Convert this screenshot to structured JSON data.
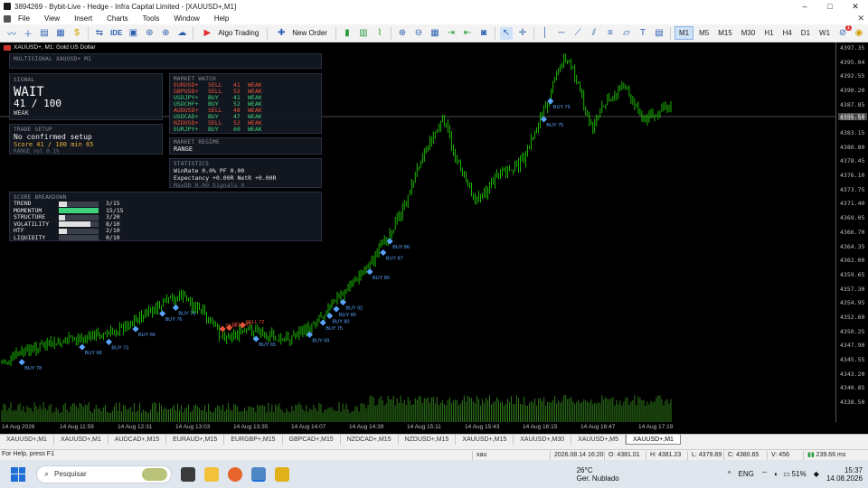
{
  "window": {
    "title": "3894269 - Bybit-Live - Hedge - Infra Capital Limited - [XAUUSD+,M1]",
    "controls": [
      "–",
      "□",
      "✕"
    ]
  },
  "menu": [
    "File",
    "View",
    "Insert",
    "Charts",
    "Tools",
    "Window",
    "Help"
  ],
  "toolbar": {
    "ide_label": "IDE",
    "algo_label": "Algo Trading",
    "neworder_label": "New Order",
    "timeframes": [
      "M1",
      "M5",
      "M15",
      "M30",
      "H1",
      "H4",
      "D1",
      "W1"
    ],
    "active_tf": "M1",
    "notif_count": "1"
  },
  "chart": {
    "symbol_title": "XAUUSD+, M1:  Gold US Dollar",
    "current_price": "4385.50",
    "price_labels": [
      "4397.35",
      "4395.04",
      "4392.55",
      "4390.20",
      "4387.85",
      "4385.50",
      "4383.15",
      "4380.80",
      "4378.45",
      "4376.10",
      "4373.75",
      "4371.40",
      "4369.05",
      "4366.70",
      "4364.35",
      "4362.00",
      "4359.65",
      "4357.30",
      "4354.95",
      "4352.60",
      "4350.25",
      "4347.90",
      "4345.55",
      "4343.20",
      "4340.85",
      "4338.50"
    ],
    "time_labels": [
      "14 Aug 2026",
      "14 Aug 11:59",
      "14 Aug 12:31",
      "14 Aug 13:03",
      "14 Aug 13:35",
      "14 Aug 14:07",
      "14 Aug 14:39",
      "14 Aug 15:11",
      "14 Aug 15:43",
      "14 Aug 16:15",
      "14 Aug 16:47",
      "14 Aug 17:19"
    ]
  },
  "panels": {
    "header": "MULTISIGNAL   XAUUSD+ M1",
    "signal": {
      "title": "SIGNAL",
      "state": "WAIT",
      "score": "41 / 100",
      "strength": "WEAK"
    },
    "trade_setup": {
      "title": "TRADE SETUP",
      "line1": "No confirmed setup",
      "line2": "Score 41 / 100   min 65",
      "line3": "RANGE   vol 0.1%"
    },
    "market_watch": {
      "title": "MARKET WATCH",
      "rows": [
        {
          "sym": "EURUSD+",
          "dir": "SELL",
          "score": "41",
          "str": "WEAK"
        },
        {
          "sym": "GBPUSD+",
          "dir": "SELL",
          "score": "52",
          "str": "WEAK"
        },
        {
          "sym": "USDJPY+",
          "dir": "BUY",
          "score": "41",
          "str": "WEAK"
        },
        {
          "sym": "USDCHF+",
          "dir": "BUY",
          "score": "52",
          "str": "WEAK"
        },
        {
          "sym": "AUDUSD+",
          "dir": "SELL",
          "score": "48",
          "str": "WEAK"
        },
        {
          "sym": "USDCAD+",
          "dir": "BUY",
          "score": "47",
          "str": "WEAK"
        },
        {
          "sym": "NZDUSD+",
          "dir": "SELL",
          "score": "52",
          "str": "WEAK"
        },
        {
          "sym": "EURJPY+",
          "dir": "BUY",
          "score": "60",
          "str": "WEAK"
        }
      ]
    },
    "regime": {
      "title": "MARKET REGIME",
      "value": "RANGE"
    },
    "statistics": {
      "title": "STATISTICS",
      "line1": "WinRate 0.0%    PF 0.00",
      "line2": "Expectancy +0.00R    NetR +0.00R",
      "line3": "MaxDD 0.00    Signals 0"
    },
    "breakdown": {
      "title": "SCORE BREAKDOWN",
      "rows": [
        {
          "name": "TREND",
          "val": "3/15",
          "frac": 0.2
        },
        {
          "name": "MOMENTUM",
          "val": "15/15",
          "frac": 1.0
        },
        {
          "name": "STRUCTURE",
          "val": "3/20",
          "frac": 0.15
        },
        {
          "name": "VOLATILITY",
          "val": "8/10",
          "frac": 0.8
        },
        {
          "name": "HTF",
          "val": "2/10",
          "frac": 0.2
        },
        {
          "name": "LIQUIDITY",
          "val": "0/10",
          "frac": 0.0
        }
      ]
    }
  },
  "signals_on_chart": [
    {
      "label": "BUY 78"
    },
    {
      "label": "BUY 68"
    },
    {
      "label": "BUY 73"
    },
    {
      "label": "BUY 66"
    },
    {
      "label": "BUY 78"
    },
    {
      "label": "BUY 76"
    },
    {
      "label": "SELL 69"
    },
    {
      "label": "SELL 63"
    },
    {
      "label": "SELL 72"
    },
    {
      "label": "BUY 65"
    },
    {
      "label": "BUY 69"
    },
    {
      "label": "BUY 80"
    },
    {
      "label": "BUY 75"
    },
    {
      "label": "BUY 92"
    },
    {
      "label": "BUY 80"
    },
    {
      "label": "BUY 80"
    },
    {
      "label": "BUY 87"
    },
    {
      "label": "BUY 86"
    },
    {
      "label": "BUY 75"
    },
    {
      "label": "BUY 76"
    }
  ],
  "tabs": [
    "XAUUSD+,M1",
    "XAUUSD+,M1",
    "AUDCAD+,M15",
    "EURAUD+,M15",
    "EURGBP+,M15",
    "GBPCAD+,M15",
    "NZDCAD+,M15",
    "NZDUSD+,M15",
    "XAUUSD+,M15",
    "XAUUSD+,M30",
    "XAUUSD+,M5",
    "XAUUSD+,M1"
  ],
  "active_tab_index": 11,
  "status": {
    "help": "For Help, press F1",
    "profile": "xau",
    "datetime": "2026.08.14 16:20",
    "open": "O: 4381.01",
    "high": "H: 4381.23",
    "low": "L: 4379.89",
    "close": "C: 4380.65",
    "volume": "V: 456",
    "ping": "239.66 ms"
  },
  "taskbar": {
    "search_placeholder": "Pesquisar",
    "temp": "26°C",
    "weather": "Ger. Nublado",
    "lang": "ENG",
    "battery": "51%",
    "time": "15:37",
    "date": "14.08.2026"
  }
}
